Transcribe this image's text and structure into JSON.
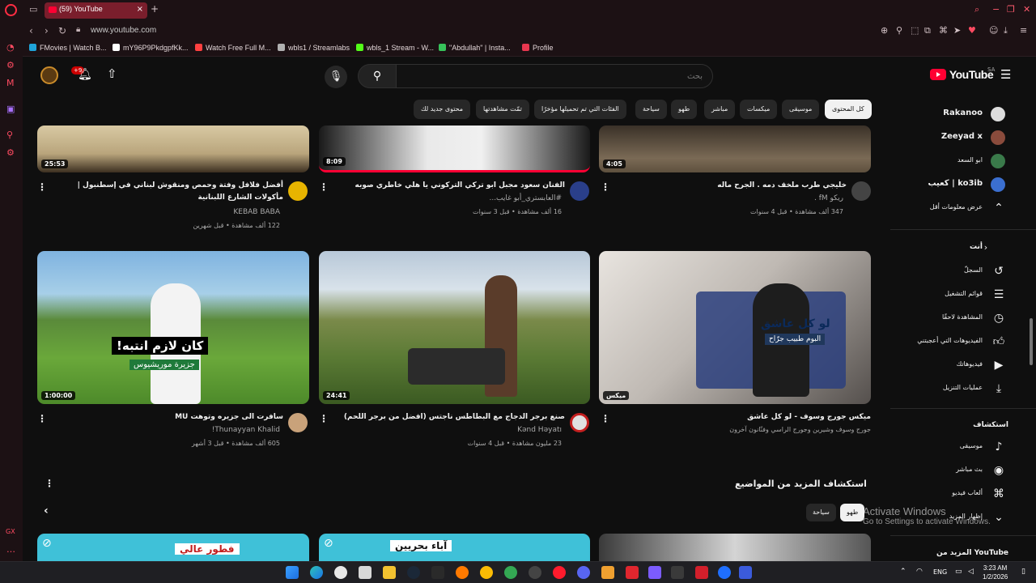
{
  "browser": {
    "tab_title": "(59) YouTube",
    "url": "www.youtube.com",
    "bookmarks": [
      "FMovies | Watch B...",
      "mY96P9PkdgpfKk...",
      "Watch Free Full M...",
      "wbls1 / Streamlabs",
      "wbls_1 Stream - W...",
      "\"Abdullah\" | Insta...",
      "Profile"
    ],
    "bookmark_colors": [
      "#1fa3d8",
      "#ffffff",
      "#ff4040",
      "#b0b0b0",
      "#53fc18",
      "#37c25a",
      "#e8374f"
    ],
    "sidebar_label": "GX"
  },
  "masthead": {
    "notifications_badge": "+9",
    "search_placeholder": "بحث",
    "logo_text": "YouTube",
    "region": "SA"
  },
  "chips": [
    {
      "label": "كل المحتوى",
      "active": true
    },
    {
      "label": "موسيقى",
      "active": false
    },
    {
      "label": "ميكسات",
      "active": false
    },
    {
      "label": "مباشر",
      "active": false
    },
    {
      "label": "طهو",
      "active": false
    },
    {
      "label": "سياحة",
      "active": false
    },
    {
      "label": "الفئات التي تم تحميلها مؤخرًا",
      "active": false
    },
    {
      "label": "تمّت مشاهدتها",
      "active": false
    },
    {
      "label": "محتوى جديد لك",
      "active": false
    }
  ],
  "videos_row1": [
    {
      "title": "خليجي طرب ملخف دمه . الجرح ماله",
      "channel": "ريكو fM .",
      "meta": "347 ألف مشاهدة • قبل 4 سنوات",
      "duration": "4:05"
    },
    {
      "title": "الفنان سعود مجبل ابو تركي التركوني يا هلي خاطري صوبه",
      "channel": "#العابستري_أبو غايب...",
      "meta": "16 ألف مشاهدة • قبل 3 سنوات",
      "duration": "8:09"
    },
    {
      "title": "أفضل فلافل وفتة وحمص ومنقوش لبناني في إسطنبول | مأكولات الشارع اللبنانية",
      "channel": "KEBAB BABA",
      "meta": "122 ألف مشاهدة • قبل شهرين",
      "duration": "25:53"
    }
  ],
  "videos_row2": [
    {
      "title": "ميكس جورج وسوف - لو كل عاشق",
      "channel": "جورج وسوف وشيرين وجورج الراسي وفنّانون آخرون",
      "meta": "",
      "duration": "ميكس",
      "thumb_text": "لو كل عاشق",
      "thumb_sub": "البوم طبيب جرّاح"
    },
    {
      "title": "صنع برجر الدجاج مع البطاطس ناجتس (افضل من برجر اللحم)",
      "channel": "Kənd Həyatı",
      "meta": "23 مليون مشاهدة • قبل 4 سنوات",
      "duration": "24:41"
    },
    {
      "title": "سافرت الى جزيره وتوهت MU",
      "channel": "Thunayyan Khalid!",
      "meta": "605 ألف مشاهدة • قبل 3 أشهر",
      "duration": "1:00:00",
      "thumb_text": "كان لازم انتبه!",
      "thumb_sub": "جزيرة موريشيوس"
    }
  ],
  "explore": {
    "title": "استكشاف المزيد من المواضيع",
    "chips": [
      {
        "label": "طهو",
        "active": true
      },
      {
        "label": "سياحة",
        "active": false
      }
    ],
    "card_texts": [
      "فطور عالي",
      "آباء بحريين"
    ]
  },
  "guide": {
    "subscriptions": [
      {
        "label": "Rakanoo",
        "color": "#dddddd"
      },
      {
        "label": "Zeeyad x",
        "color": "#8a4b3c"
      },
      {
        "label": "ابو السعد",
        "color": "#3a7a4a"
      },
      {
        "label": "ko3ib | كعيب",
        "color": "#3b6fd0"
      }
    ],
    "show_less": "عرض معلومات أقل",
    "you_header": "أنت",
    "you_items": [
      "السجلّ",
      "قوائم التشغيل",
      "المشاهدة لاحقًا",
      "الفيديوهات التي أعجبتني",
      "فيديوهاتك",
      "عمليات التنزيل"
    ],
    "explore_header": "استكشاف",
    "explore_items": [
      "موسيقى",
      "بث مباشر",
      "ألعاب فيديو"
    ],
    "show_more": "إظهار المزيد",
    "more_from": "المزيد من YouTube"
  },
  "watermark": {
    "line1": "Activate Windows",
    "line2": "Go to Settings to activate Windows."
  },
  "taskbar": {
    "lang": "ENG",
    "time": "3:23 AM",
    "date": "1/2/2026"
  }
}
